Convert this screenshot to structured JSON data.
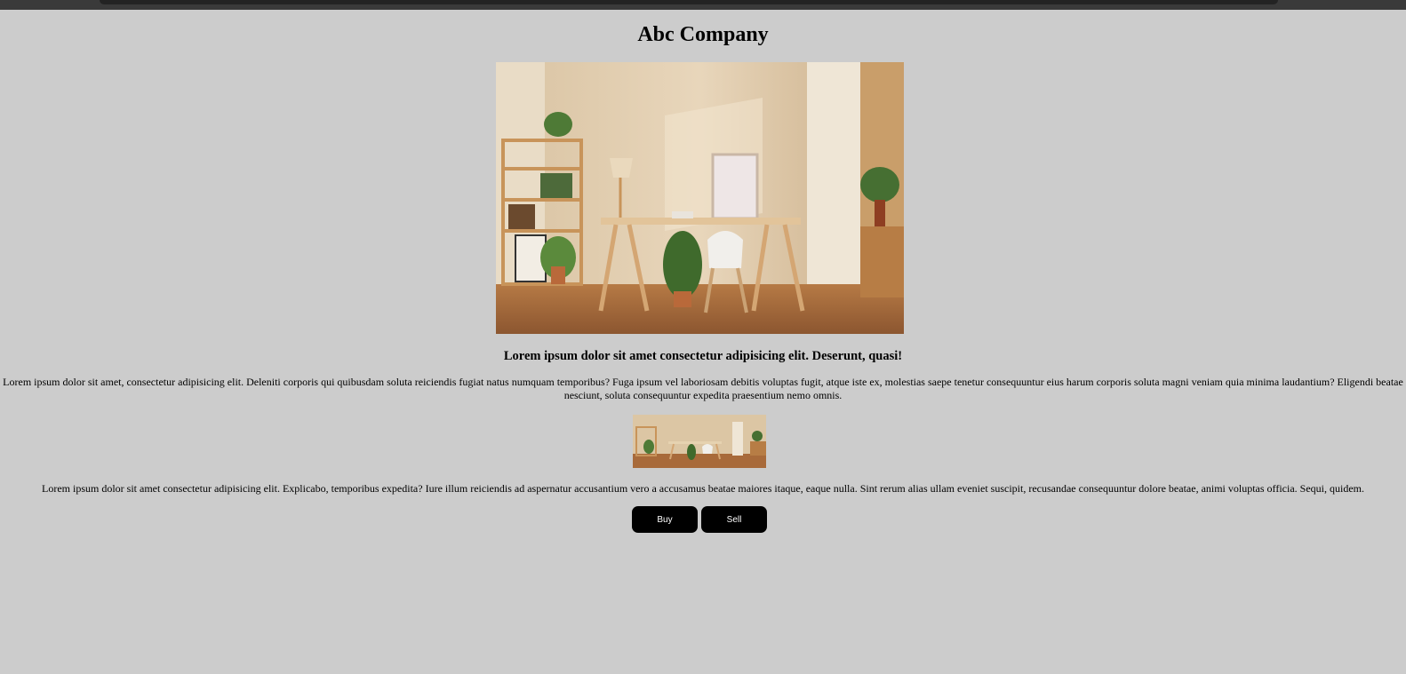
{
  "header": {
    "title": "Abc Company"
  },
  "hero_image": {
    "icon": "office-room-photo"
  },
  "headline": "Lorem ipsum dolor sit amet consectetur adipisicing elit. Deserunt, quasi!",
  "paragraph_1": "Lorem ipsum dolor sit amet, consectetur adipisicing elit. Deleniti corporis qui quibusdam soluta reiciendis fugiat natus numquam temporibus? Fuga ipsum vel laboriosam debitis voluptas fugit, atque iste ex, molestias saepe tenetur consequuntur eius harum corporis soluta magni veniam quia minima laudantium? Eligendi beatae nesciunt, soluta consequuntur expedita praesentium nemo omnis.",
  "thumbnail_image": {
    "icon": "office-room-panorama-photo"
  },
  "paragraph_2": "Lorem ipsum dolor sit amet consectetur adipisicing elit. Explicabo, temporibus expedita? Iure illum reiciendis ad aspernatur accusantium vero a accusamus beatae maiores itaque, eaque nulla. Sint rerum alias ullam eveniet suscipit, recusandae consequuntur dolore beatae, animi voluptas officia. Sequi, quidem.",
  "buttons": {
    "buy_label": "Buy",
    "sell_label": "Sell"
  },
  "colors": {
    "background": "#cccccc",
    "button_bg": "#000000",
    "button_text": "#ffffff"
  }
}
